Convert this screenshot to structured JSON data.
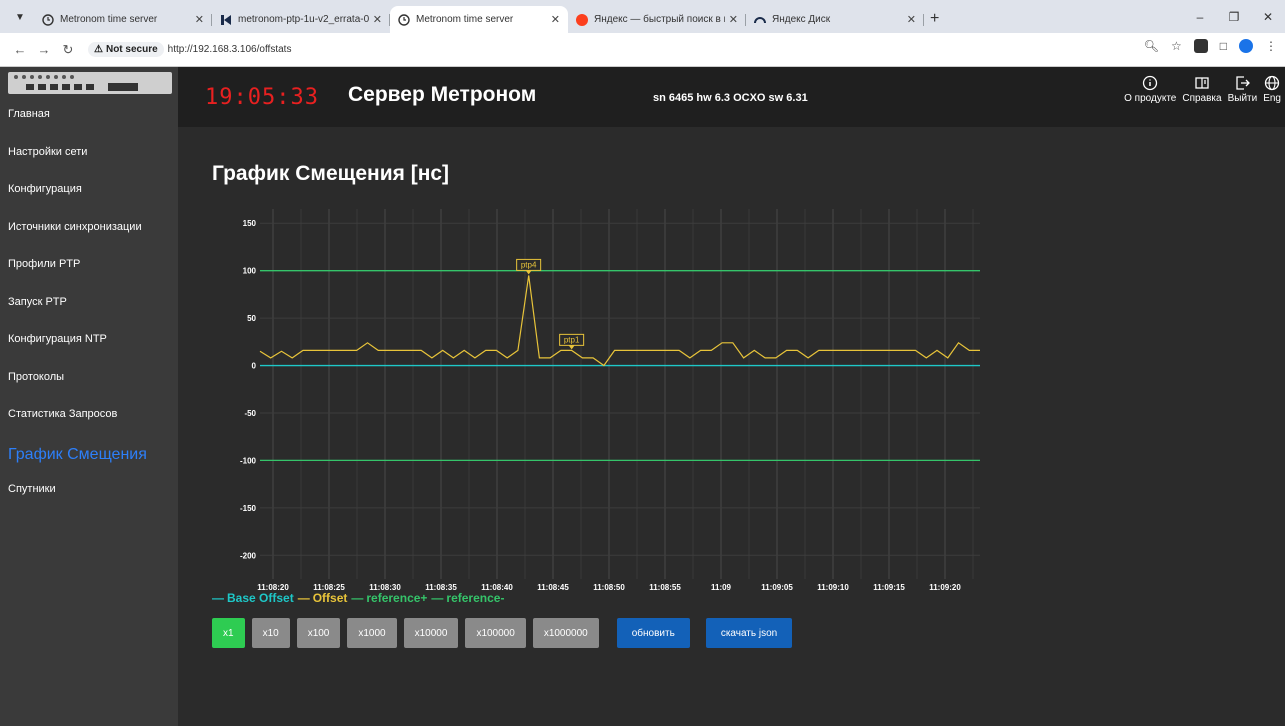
{
  "browser": {
    "tabs": [
      {
        "title": "Metronom time server",
        "icon": "clock-icon",
        "active": false
      },
      {
        "title": "metronom-ptp-1u-v2_errata-0:",
        "icon": "k-logo-icon",
        "active": false
      },
      {
        "title": "Metronom time server",
        "icon": "clock-icon",
        "active": true
      },
      {
        "title": "Яндекс — быстрый поиск в и",
        "icon": "yandex-icon",
        "active": false
      },
      {
        "title": "Яндекс Диск",
        "icon": "disk-icon",
        "active": false
      }
    ],
    "security_label": "Not secure",
    "url": "http://192.168.3.106/offstats"
  },
  "sidebar": {
    "items": [
      {
        "label": "Главная",
        "active": false
      },
      {
        "label": "Настройки сети",
        "active": false
      },
      {
        "label": "Конфигурация",
        "active": false
      },
      {
        "label": "Источники синхронизации",
        "active": false
      },
      {
        "label": "Профили PTP",
        "active": false
      },
      {
        "label": "Запуск PTP",
        "active": false
      },
      {
        "label": "Конфигурация NTP",
        "active": false
      },
      {
        "label": "Протоколы",
        "active": false
      },
      {
        "label": "Статистика Запросов",
        "active": false
      },
      {
        "label": "График Смещения",
        "active": true
      },
      {
        "label": "Спутники",
        "active": false
      }
    ]
  },
  "header": {
    "clock": "19:05:33",
    "title": "Сервер Метроном",
    "device_info": "sn 6465 hw 6.3 OCXO sw 6.31",
    "buttons": [
      {
        "label": "О продукте",
        "icon": "info-icon"
      },
      {
        "label": "Справка",
        "icon": "book-icon"
      },
      {
        "label": "Выйти",
        "icon": "logout-icon"
      },
      {
        "label": "Eng",
        "icon": "globe-icon"
      }
    ]
  },
  "page": {
    "title": "График Смещения [нс]"
  },
  "chart_data": {
    "type": "line",
    "title": "График Смещения [нс]",
    "xlabel": "",
    "ylabel": "",
    "ylim": [
      -225,
      165
    ],
    "yticks": [
      150,
      100,
      50,
      0,
      -50,
      -100,
      -150,
      -200
    ],
    "xtick_labels": [
      "11:08:20",
      "11:08:25",
      "11:08:30",
      "11:08:35",
      "11:08:40",
      "11:08:45",
      "11:08:50",
      "11:08:55",
      "11:09",
      "11:09:05",
      "11:09:10",
      "11:09:15",
      "11:09:20"
    ],
    "x_start_label": "11:08:20",
    "grid": true,
    "legend": "bottom-left",
    "series": [
      {
        "name": "Base Offset",
        "color": "#1ec8c8",
        "constant": 0
      },
      {
        "name": "Offset",
        "color": "#e8c43a",
        "values": [
          15,
          8,
          15,
          8,
          16,
          16,
          16,
          16,
          16,
          16,
          24,
          16,
          16,
          16,
          16,
          16,
          8,
          16,
          8,
          16,
          8,
          16,
          16,
          8,
          16,
          95,
          8,
          8,
          16,
          16,
          8,
          8,
          0,
          16,
          16,
          16,
          16,
          16,
          16,
          16,
          8,
          16,
          16,
          24,
          24,
          8,
          16,
          8,
          8,
          16,
          16,
          8,
          16,
          16,
          16,
          16,
          16,
          16,
          16,
          16,
          16,
          16,
          8,
          16,
          8,
          24,
          16,
          16
        ]
      },
      {
        "name": "reference+",
        "color": "#35c46a",
        "constant": 100
      },
      {
        "name": "reference-",
        "color": "#35c46a",
        "constant": -100
      }
    ],
    "annotations": [
      {
        "text": "ptp4",
        "point_index": 25
      },
      {
        "text": "ptp1",
        "point_index": 29
      }
    ]
  },
  "controls": {
    "scale_buttons": [
      {
        "label": "x1",
        "active": true
      },
      {
        "label": "x10",
        "active": false
      },
      {
        "label": "x100",
        "active": false
      },
      {
        "label": "x1000",
        "active": false
      },
      {
        "label": "x10000",
        "active": false
      },
      {
        "label": "x100000",
        "active": false
      },
      {
        "label": "x1000000",
        "active": false
      }
    ],
    "refresh_label": "обновить",
    "download_label": "скачать json"
  },
  "colors": {
    "accent_active_nav": "#2d7ff9",
    "clock": "#e82020",
    "scale_active": "#2ecc52",
    "action_button": "#1361b8"
  }
}
